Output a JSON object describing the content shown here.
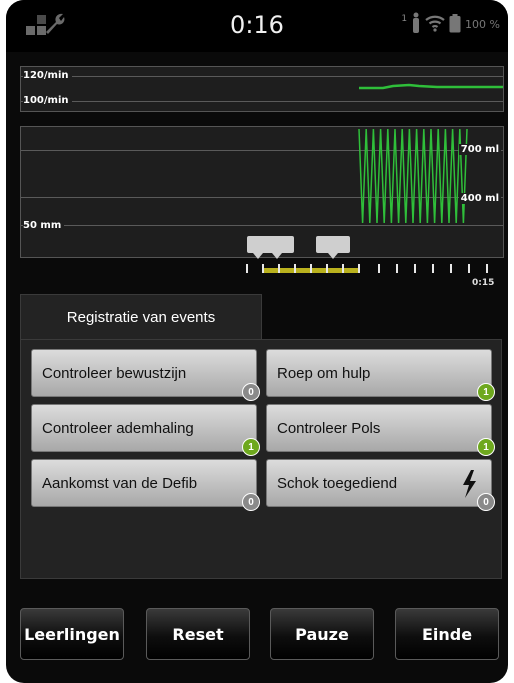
{
  "status": {
    "time": "0:16",
    "signal_number": "1",
    "battery_percent": "100 %"
  },
  "rate_chart": {
    "labels": [
      "120/min",
      "100/min"
    ]
  },
  "depth_chart": {
    "labels": [
      "700 ml",
      "400 ml",
      "50 mm"
    ]
  },
  "timeline": {
    "end_label": "0:15"
  },
  "events": {
    "tab_label": "Registratie van events",
    "buttons": [
      {
        "label": "Controleer bewustzijn",
        "count": "0"
      },
      {
        "label": "Roep om hulp",
        "count": "1"
      },
      {
        "label": "Controleer ademhaling",
        "count": "1"
      },
      {
        "label": "Controleer Pols",
        "count": "1"
      },
      {
        "label": "Aankomst van de Defib",
        "count": "0"
      },
      {
        "label": "Schok toegediend",
        "count": "0",
        "icon": "lightning-bolt-icon"
      }
    ]
  },
  "footer": {
    "buttons": [
      "Leerlingen",
      "Reset",
      "Pauze",
      "Einde"
    ]
  },
  "colors": {
    "accent_green": "#2fbf3a",
    "badge_green": "#6ea81e",
    "timeline_yellow": "#b9b11e"
  }
}
